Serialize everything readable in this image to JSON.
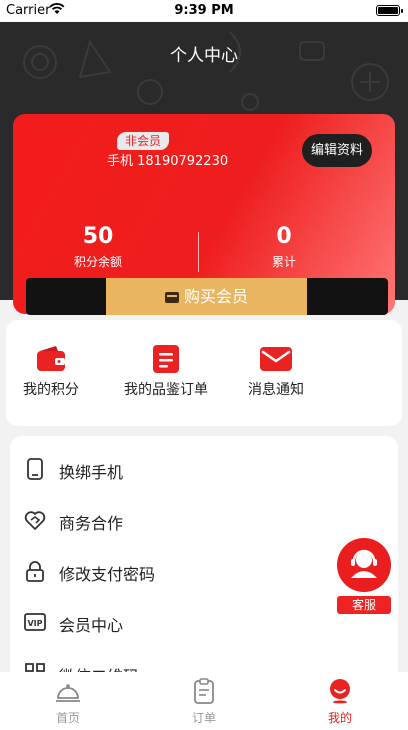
{
  "status_bar": {
    "carrier": "Carrier",
    "time": "9:39 PM"
  },
  "header": {
    "title": "个人中心"
  },
  "profile": {
    "member_badge": "非会员",
    "phone": "手机 18190792230",
    "edit_button": "编辑资料"
  },
  "stats": [
    {
      "value": "50",
      "label": "积分余额"
    },
    {
      "value": "0",
      "label": "累计"
    }
  ],
  "buy_member": {
    "label": "购买会员"
  },
  "quick_actions": [
    {
      "label": "我的积分",
      "icon": "wallet-icon"
    },
    {
      "label": "我的品鉴订单",
      "icon": "order-icon"
    },
    {
      "label": "消息通知",
      "icon": "mail-icon"
    }
  ],
  "menu": [
    {
      "label": "换绑手机",
      "icon": "phone-icon"
    },
    {
      "label": "商务合作",
      "icon": "handshake-icon"
    },
    {
      "label": "修改支付密码",
      "icon": "lock-icon"
    },
    {
      "label": "会员中心",
      "icon": "vip-icon"
    },
    {
      "label": "微信二维码",
      "icon": "qrcode-icon"
    }
  ],
  "customer_service": {
    "label": "客服"
  },
  "tabs": [
    {
      "label": "首页",
      "icon": "cloche-icon",
      "active": false
    },
    {
      "label": "订单",
      "icon": "clipboard-icon",
      "active": false
    },
    {
      "label": "我的",
      "icon": "user-icon",
      "active": true
    }
  ],
  "colors": {
    "accent": "#e8201f",
    "gold": "#e9b560",
    "dark": "#2a2a2a"
  }
}
